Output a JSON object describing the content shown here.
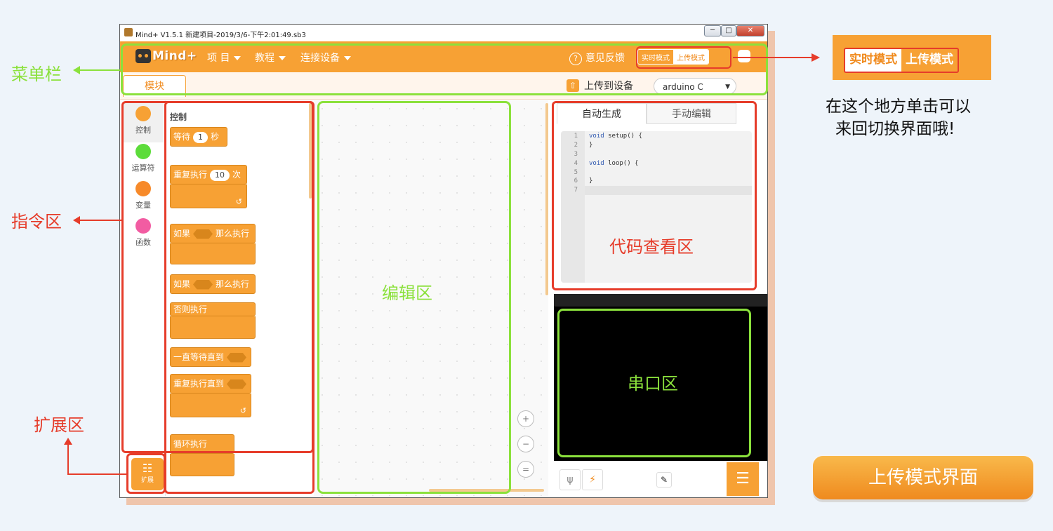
{
  "window": {
    "title": "Mind+ V1.5.1     新建项目-2019/3/6-下午2:01:49.sb3",
    "min_label": "─",
    "max_label": "□",
    "close_label": "✕"
  },
  "menubar": {
    "logo": "Mind+",
    "items": [
      "项 目",
      "教程",
      "连接设备"
    ],
    "feedback": "意见反馈",
    "mode_realtime": "实时模式",
    "mode_upload": "上传模式"
  },
  "toolbar": {
    "module_tab": "模块",
    "upload_button": "上传到设备",
    "board": "arduino C"
  },
  "categories": [
    {
      "label": "控制",
      "color": "#f7a134"
    },
    {
      "label": "运算符",
      "color": "#5cdc3a"
    },
    {
      "label": "变量",
      "color": "#f78a2a"
    },
    {
      "label": "函数",
      "color": "#f25ca2"
    }
  ],
  "extension_label": "扩展",
  "blocks": {
    "title": "控制",
    "wait": "等待",
    "wait_value": "1",
    "wait_unit": "秒",
    "repeat": "重复执行",
    "repeat_value": "10",
    "repeat_unit": "次",
    "if1": "如果",
    "then1": "那么执行",
    "if2": "如果",
    "then2": "那么执行",
    "else": "否则执行",
    "wait_until": "一直等待直到",
    "repeat_until": "重复执行直到",
    "forever": "循环执行"
  },
  "code_panel": {
    "tab_auto": "自动生成",
    "tab_manual": "手动编辑",
    "lines": [
      "1",
      "2",
      "3",
      "4",
      "5",
      "6",
      "7"
    ],
    "code_setup_kw": "void",
    "code_setup": " setup() {",
    "code_close1": "}",
    "code_loop_kw": "void",
    "code_loop": " loop() {",
    "code_close2": "}"
  },
  "annotations": {
    "menubar": "菜单栏",
    "command_area": "指令区",
    "extension_area": "扩展区",
    "edit_area": "编辑区",
    "code_view_area": "代码查看区",
    "serial_area": "串口区",
    "callout_realtime": "实时模式",
    "callout_upload": "上传模式",
    "note_line1": "在这个地方单击可以",
    "note_line2": "来回切换界面哦!",
    "upload_mode_button": "上传模式界面"
  },
  "colors": {
    "brand_orange": "#f7a134",
    "annotation_red": "#e63c2a",
    "annotation_green": "#8be13c"
  },
  "icons": [
    "robot-logo-icon",
    "help-icon",
    "settings-icon",
    "upload-icon",
    "zoom-in-icon",
    "zoom-out-icon",
    "zoom-reset-icon",
    "usb-icon",
    "plugin-icon",
    "serial-icon",
    "list-icon",
    "extension-icon"
  ]
}
